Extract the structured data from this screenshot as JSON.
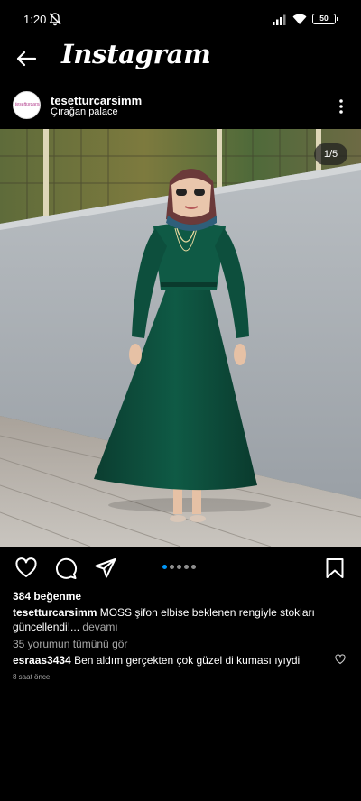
{
  "status_bar": {
    "time": "1:20",
    "battery": "50",
    "icons": [
      "mute-icon",
      "signal-icon",
      "wifi-icon",
      "battery-icon"
    ]
  },
  "header": {
    "brand": "Instagram",
    "back_icon": "arrow-left-icon"
  },
  "post": {
    "username": "tesetturcarsimm",
    "location": "Çırağan palace",
    "avatar_text": "tesetturcarsim",
    "image_counter": "1/5",
    "current_image": 1,
    "total_images": 5,
    "likes": "384 beğenme",
    "caption": {
      "user": "tesetturcarsimm",
      "text": "MOSS şifon elbise beklenen rengiyle stokları güncellendi!...",
      "more": "devamı"
    },
    "view_comments": "35 yorumun tümünü gör",
    "comment": {
      "user": "esraas3434",
      "text": "Ben aldım gerçekten çok güzel di kuması ıyıydi"
    },
    "time_ago": "8 saat önce"
  },
  "colors": {
    "background": "#000000",
    "accent_dot": "#0095f6",
    "muted_text": "#a8a8a8",
    "dress": "#0f5340"
  }
}
